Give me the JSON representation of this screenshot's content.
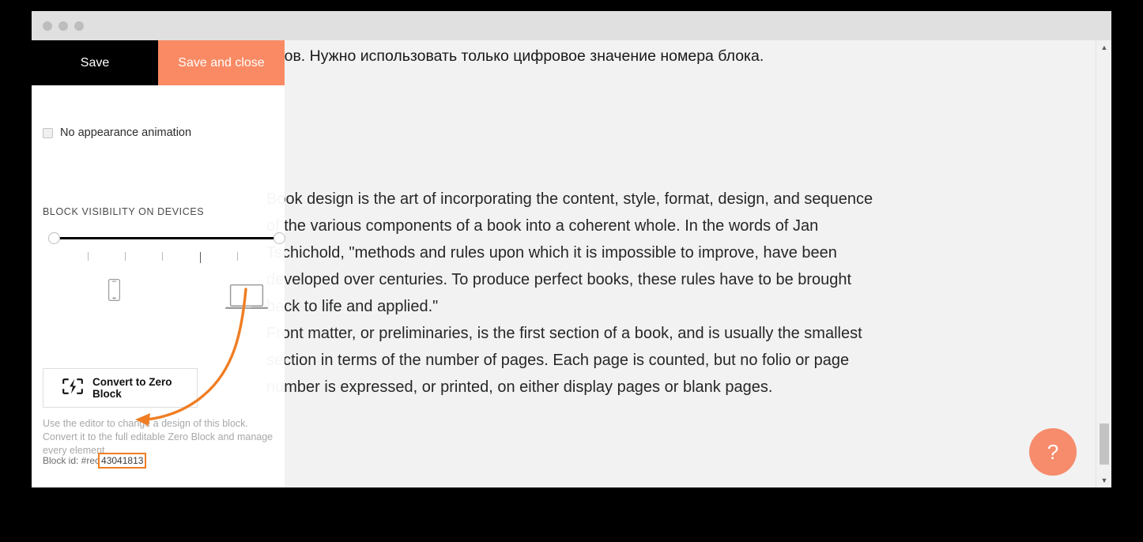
{
  "window": {
    "titlebar_dots": [
      "close-dot",
      "minimize-dot",
      "zoom-dot"
    ]
  },
  "panel": {
    "save_label": "Save",
    "save_and_close_label": "Save and close",
    "no_animation_label": "No appearance animation",
    "no_animation_checked": false,
    "section_title": "BLOCK VISIBILITY ON DEVICES",
    "slider": {
      "left_handle_label": "mobile-handle",
      "right_handle_label": "desktop-handle",
      "tick_count": 5
    },
    "device_left": "phone-icon",
    "device_right": "laptop-icon",
    "convert_button_label": "Convert to Zero Block",
    "convert_icon": "zero-block-bolt-icon",
    "convert_hint": "Use the editor to change a design of this block. Convert it to the full editable Zero Block and manage every element",
    "block_id_prefix": "Block id: #rec",
    "block_id_value": "43041813"
  },
  "content": {
    "headline_ru": "оков. Нужно использовать только цифровое значение номера блока.",
    "paragraph_1": "Book design is the art of incorporating the content, style, format, design, and sequence of the various components of a book into a coherent whole. In the words of Jan Tschichold, \"methods and rules upon which it is impossible to improve, have been developed over centuries. To produce perfect books, these rules have to be brought back to life and applied.\"",
    "paragraph_2": "Front matter, or preliminaries, is the first section of a book, and is usually the smallest section in terms of the number of pages. Each page is counted, but no folio or page number is expressed, or printed, on either display pages or blank pages."
  },
  "help": {
    "label": "?"
  },
  "scrollbar": {
    "up_arrow": "▲",
    "down_arrow": "▼"
  },
  "colors": {
    "accent_orange": "#f98a64",
    "annotation_orange": "#f07d22",
    "save_black": "#000000"
  }
}
